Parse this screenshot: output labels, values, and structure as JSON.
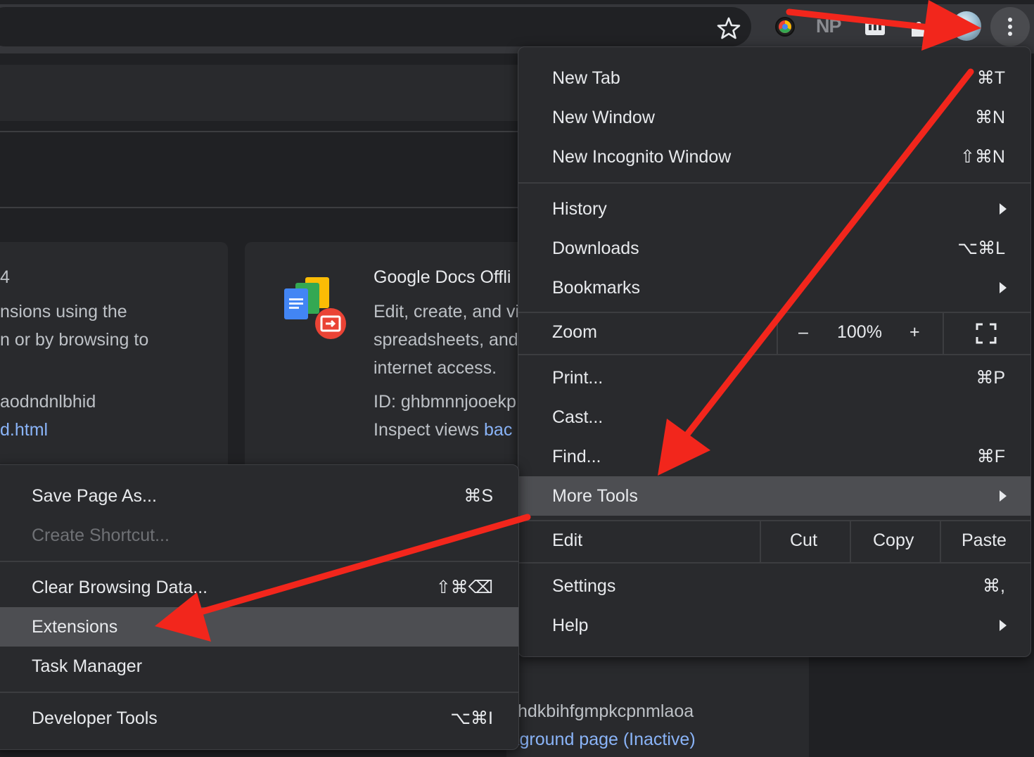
{
  "toolbar": {
    "extension_np_label": "NP"
  },
  "page": {
    "card_left": {
      "line1": "4",
      "line2": "nsions using the",
      "line3": "n or by browsing to",
      "line4": "aodndnlbhid",
      "line5": "d.html"
    },
    "card_right": {
      "title": "Google Docs Offli",
      "desc1": "Edit, create, and vi",
      "desc2": "spreadsheets, and",
      "desc3": "internet access.",
      "id_text": "ID: ghbmnnjooekp",
      "inspect_prefix": "Inspect views ",
      "inspect_link": "bac"
    },
    "bottom": {
      "id_fragment": "hdkbihfgmpkcpnmlaoa",
      "link_fragment": "kground page (Inactive)"
    }
  },
  "main_menu": {
    "new_tab": {
      "label": "New Tab",
      "shortcut": "⌘T"
    },
    "new_window": {
      "label": "New Window",
      "shortcut": "⌘N"
    },
    "new_incognito": {
      "label": "New Incognito Window",
      "shortcut": "⇧⌘N"
    },
    "history": {
      "label": "History"
    },
    "downloads": {
      "label": "Downloads",
      "shortcut": "⌥⌘L"
    },
    "bookmarks": {
      "label": "Bookmarks"
    },
    "zoom": {
      "label": "Zoom",
      "minus": "–",
      "value": "100%",
      "plus": "+"
    },
    "print": {
      "label": "Print...",
      "shortcut": "⌘P"
    },
    "cast": {
      "label": "Cast..."
    },
    "find": {
      "label": "Find...",
      "shortcut": "⌘F"
    },
    "more_tools": {
      "label": "More Tools"
    },
    "edit": {
      "label": "Edit",
      "cut": "Cut",
      "copy": "Copy",
      "paste": "Paste"
    },
    "settings": {
      "label": "Settings",
      "shortcut": "⌘,"
    },
    "help": {
      "label": "Help"
    }
  },
  "sub_menu": {
    "save_page": {
      "label": "Save Page As...",
      "shortcut": "⌘S"
    },
    "create_shortcut": {
      "label": "Create Shortcut..."
    },
    "clear_browsing": {
      "label": "Clear Browsing Data...",
      "shortcut": "⇧⌘⌫"
    },
    "extensions": {
      "label": "Extensions"
    },
    "task_manager": {
      "label": "Task Manager"
    },
    "developer_tools": {
      "label": "Developer Tools",
      "shortcut": "⌥⌘I"
    }
  },
  "colors": {
    "annotation_arrow": "#f2261c",
    "menu_bg": "#292a2d",
    "highlight_bg": "#4d4e52",
    "link": "#8ab4f8"
  }
}
